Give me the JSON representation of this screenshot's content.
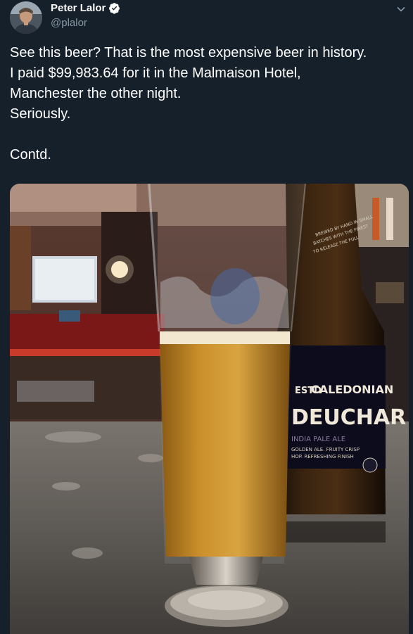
{
  "author": {
    "name": "Peter Lalor",
    "handle": "@plalor"
  },
  "tweet": {
    "text": "See this beer? That is the most expensive beer in history.\nI paid $99,983.64 for it in the Malmaison Hotel,\nManchester the other night.\nSeriously.\n\nContd."
  },
  "photo": {
    "bottle_label_brand": "CALEDONIAN",
    "bottle_label_name": "DEUCHAR",
    "bottle_label_prefix": "ESTD",
    "bottle_label_style": "INDIA PALE ALE",
    "bottle_label_desc1": "GOLDEN ALE. FRUITY CRISP",
    "bottle_label_desc2": "HOP. REFRESHING FINISH",
    "bottle_neck_text1": "BREWED BY HAND IN SMALL",
    "bottle_neck_text2": "BATCHES WITH THE FINEST",
    "bottle_neck_text3": "TO RELEASE THE FULL"
  },
  "colors": {
    "background": "#15202b",
    "secondary_text": "#8899a6",
    "verified_blue": "#ffffff"
  }
}
